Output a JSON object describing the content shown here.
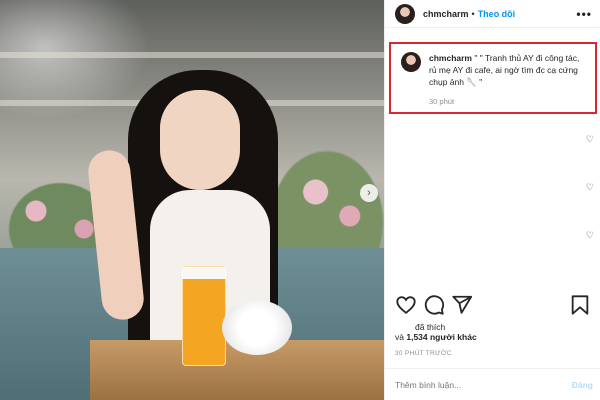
{
  "post": {
    "username": "chmcharm",
    "separator": "•",
    "follow_label": "Theo dõi",
    "more_icon": "more-horizontal-icon",
    "more_label": "•••"
  },
  "caption": {
    "username": "chmcharm",
    "text": "\" \" Tranh thủ AY đi công tác, rủ mẹ AY đi cafe, ai ngờ tìm đc cạ cứng chụp ảnh 🥄 \"",
    "time": "30 phút",
    "highlight_color": "#d8272f"
  },
  "comment_likes": [
    "♡",
    "♡",
    "♡"
  ],
  "photo": {
    "next_arrow": "›",
    "alt": "Cô gái cầm thìa ăn tráng miệng trong quán cafe"
  },
  "actions": {
    "like_icon": "heart-icon",
    "comment_icon": "comment-icon",
    "share_icon": "send-icon",
    "save_icon": "bookmark-icon"
  },
  "likes": {
    "prefix": "đã thích",
    "connector": "và",
    "count": "1,534 người khác"
  },
  "timestamp": "30 PHÚT TRƯỚC",
  "comment": {
    "placeholder": "Thêm bình luận...",
    "post_label": "Đăng"
  },
  "colors": {
    "accent": "#0095f6",
    "muted": "#8e8e8e"
  }
}
